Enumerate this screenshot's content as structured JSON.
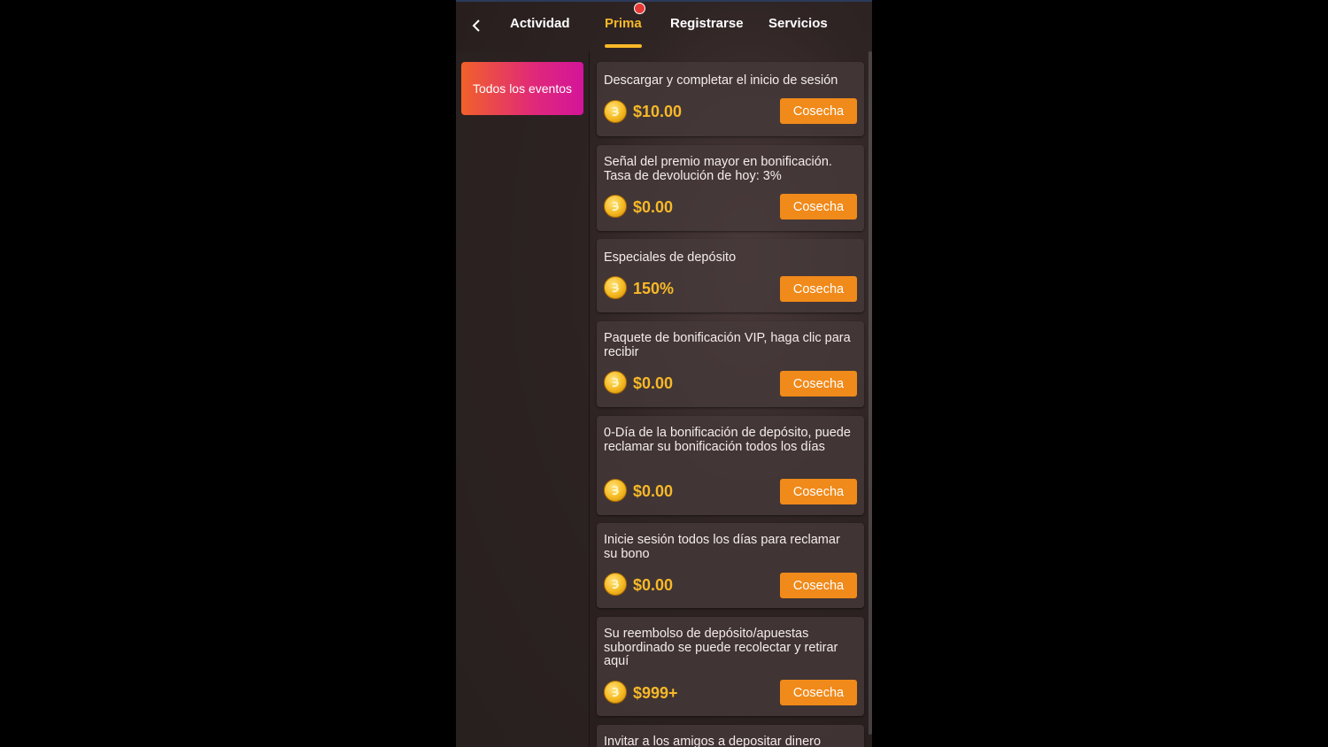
{
  "header": {
    "tabs": [
      {
        "label": "Actividad"
      },
      {
        "label": "Prima"
      },
      {
        "label": "Registrarse"
      },
      {
        "label": "Servicios"
      }
    ],
    "active_tab": "Prima"
  },
  "sidebar": {
    "items": [
      {
        "label": "Todos los eventos"
      }
    ]
  },
  "promotions": [
    {
      "title": "Descargar y completar el inicio de sesión",
      "amount": "$10.00",
      "button": "Cosecha"
    },
    {
      "title": "Señal del premio mayor en bonificación. Tasa de devolución de hoy: 3%",
      "amount": "$0.00",
      "button": "Cosecha"
    },
    {
      "title": "Especiales de depósito",
      "amount": "150%",
      "button": "Cosecha"
    },
    {
      "title": "Paquete de bonificación VIP, haga clic para recibir",
      "amount": "$0.00",
      "button": "Cosecha"
    },
    {
      "title": "0-Día de la bonificación de depósito, puede reclamar su bonificación todos los días",
      "amount": "$0.00",
      "button": "Cosecha"
    },
    {
      "title": "Inicie sesión todos los días para reclamar su bono",
      "amount": "$0.00",
      "button": "Cosecha"
    },
    {
      "title": "Su reembolso de depósito/apuestas subordinado se puede recolectar y retirar aquí",
      "amount": "$999+",
      "button": "Cosecha"
    },
    {
      "title": "Invitar a los amigos a depositar dinero"
    }
  ],
  "colors": {
    "accent": "#f7b928",
    "button": "#f08a1a",
    "sidebar_gradient_start": "#f1612a",
    "sidebar_gradient_end": "#d4149a"
  }
}
